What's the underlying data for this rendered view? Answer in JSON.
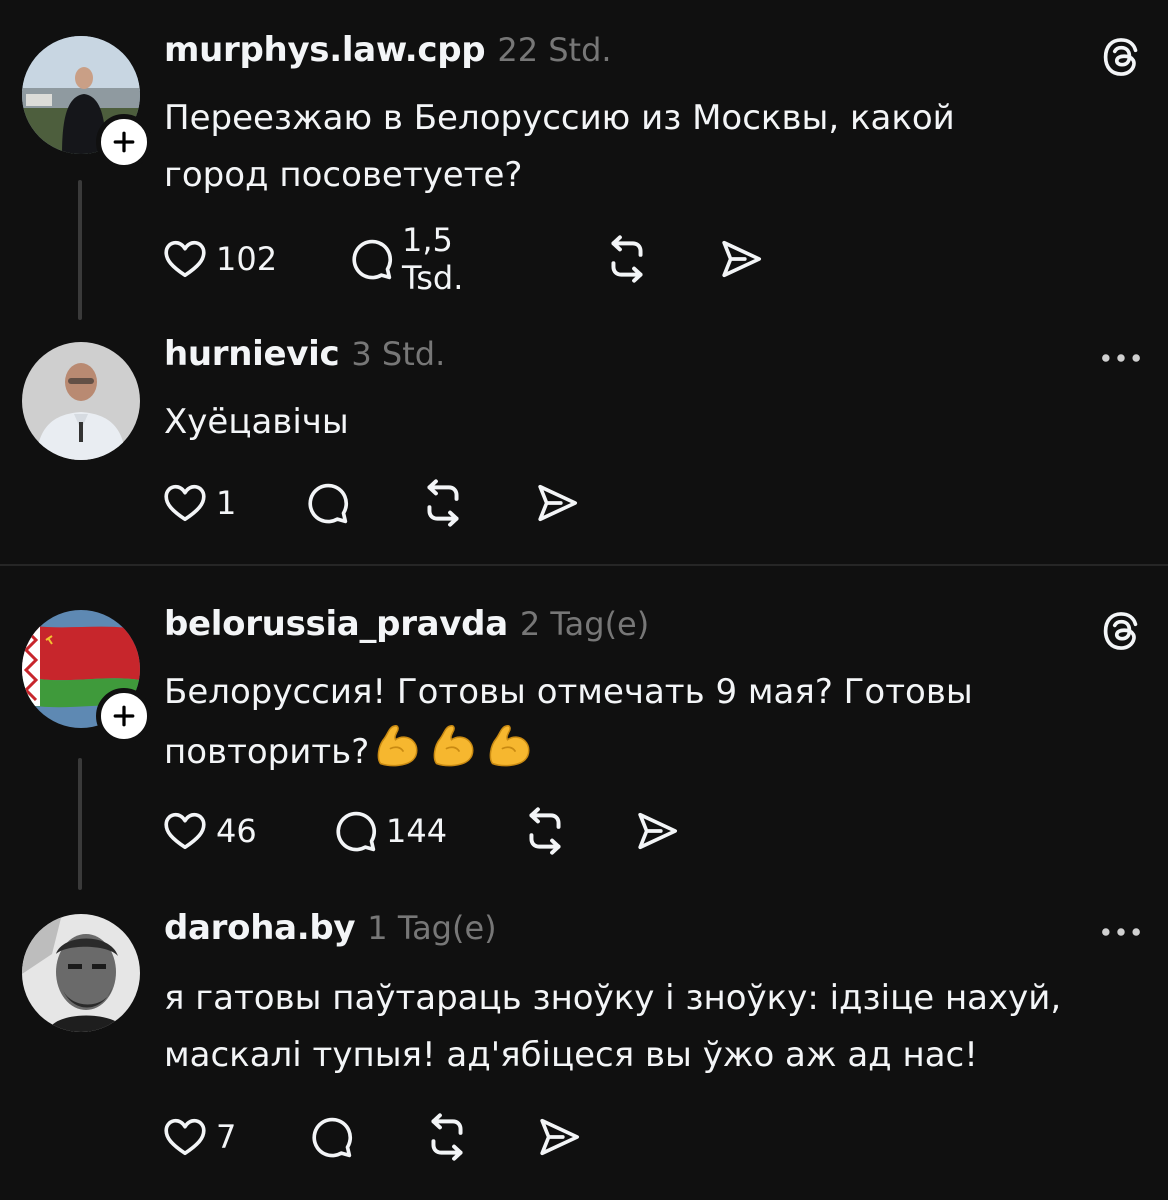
{
  "posts": [
    {
      "username": "murphys.law.cpp",
      "time": "22 Std.",
      "text_line1": "Переезжаю в Белоруссию из Москвы, какой",
      "text_line2": "город посоветуете?",
      "likes": "102",
      "replies": "1,5 Tsd.",
      "corner_icon": "threads-logo-icon",
      "avatar_icon": "user-photo-avatar"
    },
    {
      "username": "hurnievic",
      "time": "3 Std.",
      "text_line1": "Хуёцавічы",
      "likes": "1",
      "corner_icon": "more-options-icon",
      "avatar_icon": "user-photo-avatar"
    },
    {
      "username": "belorussia_pravda",
      "time": "2 Tag(e)",
      "text_line1": "Белоруссия! Готовы отмечать 9 мая? Готовы",
      "text_line2": "повторить?",
      "emoji": [
        "flexed-biceps-emoji",
        "flexed-biceps-emoji",
        "flexed-biceps-emoji"
      ],
      "likes": "46",
      "replies": "144",
      "corner_icon": "threads-logo-icon",
      "avatar_icon": "flag-avatar"
    },
    {
      "username": "daroha.by",
      "time": "1 Tag(e)",
      "text_line1": "я гатовы паўтараць зноўку і зноўку: ідзіце нахуй,",
      "text_line2": "маскалі тупыя! ад'ябіцеся вы ўжо аж ад нас!",
      "likes": "7",
      "corner_icon": "more-options-icon",
      "avatar_icon": "user-photo-avatar"
    }
  ],
  "colors": {
    "background": "#101010",
    "primary_text": "#f3f5f7",
    "secondary_text": "#777777",
    "thread_line": "#3a3a3a",
    "divider": "#262626"
  }
}
